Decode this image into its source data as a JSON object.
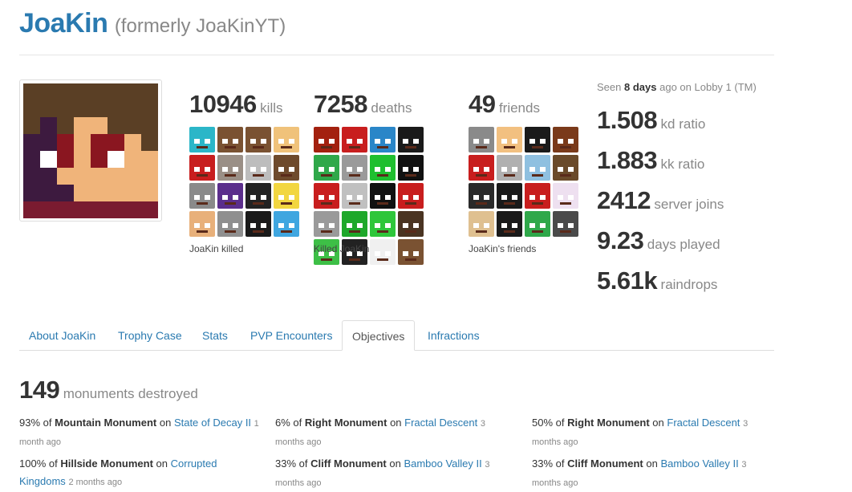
{
  "profile": {
    "name": "JoaKin",
    "former": "(formerly JoaKinYT)"
  },
  "stats": {
    "kills": {
      "value": "10946",
      "unit": "kills",
      "caption": "JoaKin killed"
    },
    "deaths": {
      "value": "7258",
      "unit": "deaths",
      "caption": "Killed JoaKin"
    },
    "friends": {
      "value": "49",
      "unit": "friends",
      "caption": "JoaKin's friends"
    }
  },
  "seen": {
    "prefix": "Seen",
    "amount": "8 days",
    "middle": "ago on",
    "server": "Lobby 1 (TM)"
  },
  "right_stats": [
    {
      "value": "1.508",
      "unit": "kd ratio"
    },
    {
      "value": "1.883",
      "unit": "kk ratio"
    },
    {
      "value": "2412",
      "unit": "server joins"
    },
    {
      "value": "9.23",
      "unit": "days played"
    },
    {
      "value": "5.61k",
      "unit": "raindrops"
    }
  ],
  "tabs": [
    {
      "label": "About JoaKin"
    },
    {
      "label": "Trophy Case"
    },
    {
      "label": "Stats"
    },
    {
      "label": "PVP Encounters"
    },
    {
      "label": "Objectives"
    },
    {
      "label": "Infractions"
    }
  ],
  "active_tab": "Objectives",
  "objectives": {
    "count": "149",
    "label": "monuments destroyed",
    "entries": [
      {
        "percent": "93%",
        "of": "of",
        "monument": "Mountain Monument",
        "on": "on",
        "map": "State of Decay II",
        "time": "1 month ago"
      },
      {
        "percent": "6%",
        "of": "of",
        "monument": "Right Monument",
        "on": "on",
        "map": "Fractal Descent",
        "time": "3 months ago"
      },
      {
        "percent": "50%",
        "of": "of",
        "monument": "Right Monument",
        "on": "on",
        "map": "Fractal Descent",
        "time": "3 months ago"
      },
      {
        "percent": "100%",
        "of": "of",
        "monument": "Hillside Monument",
        "on": "on",
        "map": "Corrupted Kingdoms",
        "time": "2 months ago"
      },
      {
        "percent": "33%",
        "of": "of",
        "monument": "Cliff Monument",
        "on": "on",
        "map": "Bamboo Valley II",
        "time": "3 months ago"
      },
      {
        "percent": "33%",
        "of": "of",
        "monument": "Cliff Monument",
        "on": "on",
        "map": "Bamboo Valley II",
        "time": "3 months ago"
      }
    ]
  },
  "colors": {
    "link": "#2a7ab0",
    "muted": "#888888",
    "divider": "#e5e5e5"
  }
}
